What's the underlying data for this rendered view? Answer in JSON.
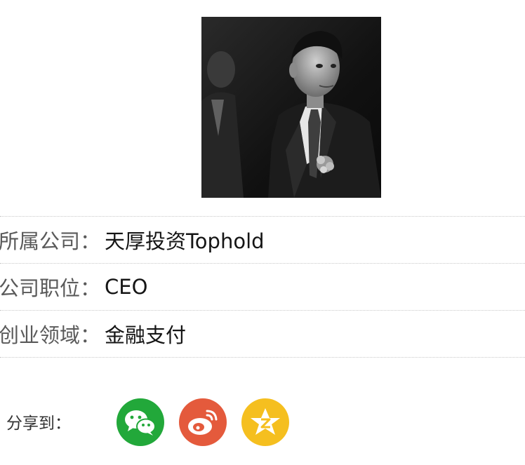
{
  "profile": {
    "photo_icon": "person-portrait-photo"
  },
  "info_rows": [
    {
      "label": "所属公司：",
      "value": "天厚投资Tophold"
    },
    {
      "label": "公司职位：",
      "value": "CEO"
    },
    {
      "label": "创业领域：",
      "value": "金融支付"
    }
  ],
  "share": {
    "label": "分享到：",
    "buttons": [
      {
        "icon": "wechat-icon",
        "color": "#22a83a"
      },
      {
        "icon": "weibo-icon",
        "color": "#e45a3c"
      },
      {
        "icon": "qzone-icon",
        "color": "#f5bf1f"
      }
    ]
  }
}
